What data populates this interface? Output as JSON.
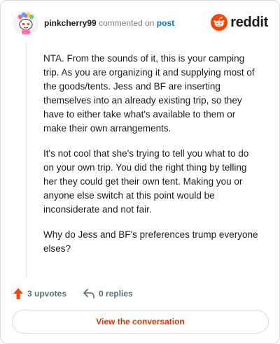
{
  "header": {
    "username": "pinkcherry99",
    "action_text": "commented on",
    "post_link": "post",
    "brand": "reddit",
    "brand_color": "#ff4500"
  },
  "comment": {
    "paragraphs": [
      "NTA. From the sounds of it, this is your camping trip. As you are organizing it and supplying most of the goods/tents. Jess and BF are inserting themselves into an already existing trip, so they have to either take what's available to them or make their own arrangements.",
      "It's not cool that she's trying to tell you what to do on your own trip. You did the right thing by telling her they could get their own tent. Making you or anyone else switch at this point would be inconsiderate and not fair.",
      "Why do Jess and BF's preferences trump everyone elses?"
    ]
  },
  "actions": {
    "upvotes": "3 upvotes",
    "replies": "0 replies",
    "upvote_icon": "upvote-arrow-icon",
    "reply_icon": "reply-arrow-icon"
  },
  "cta": {
    "label": "View the conversation",
    "color": "#d93900"
  }
}
